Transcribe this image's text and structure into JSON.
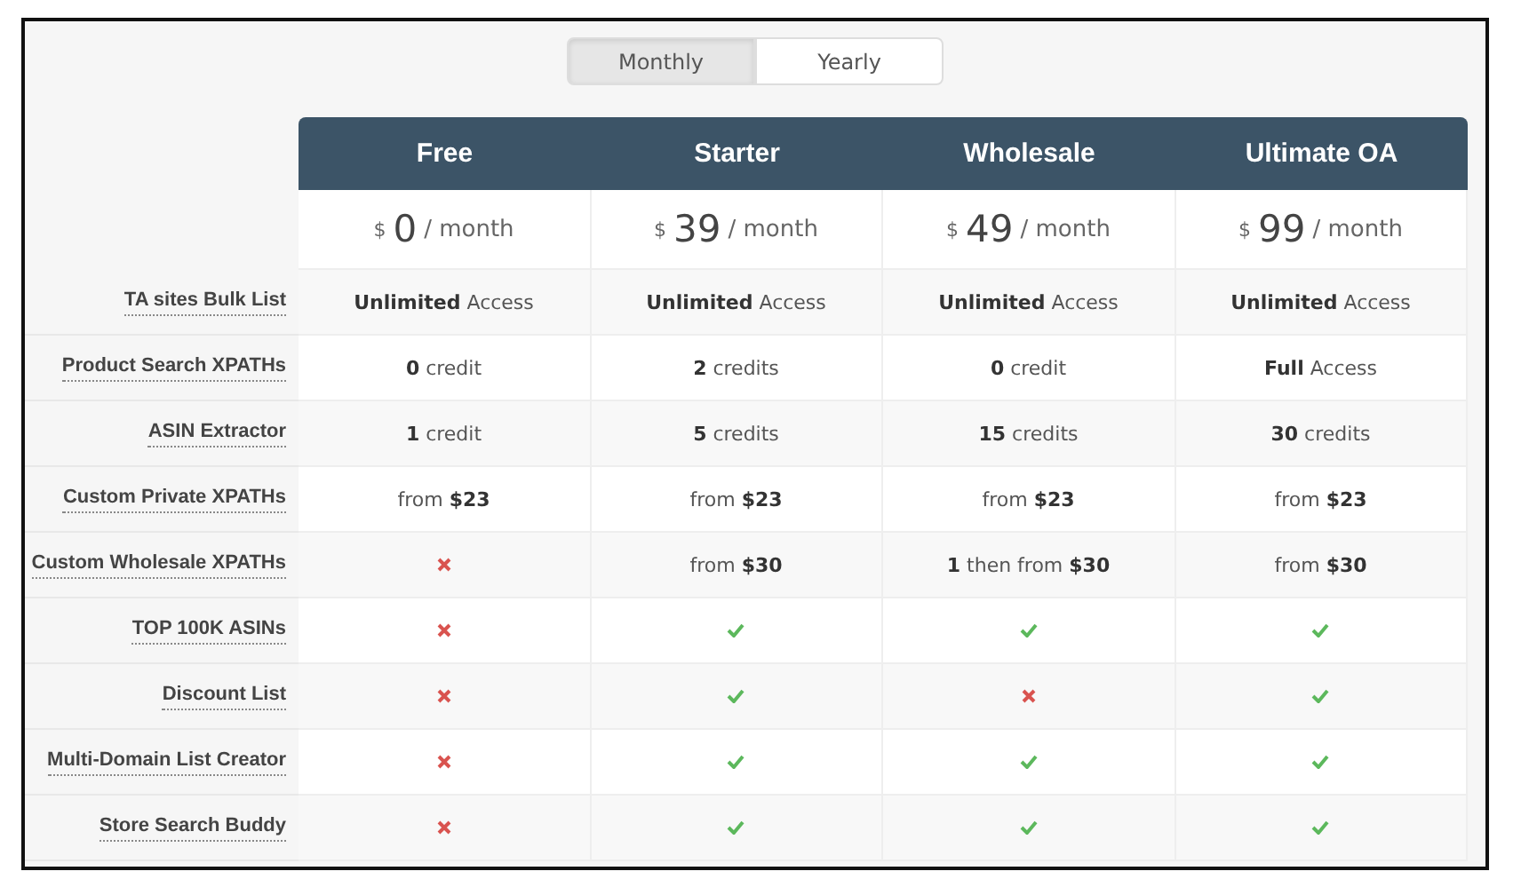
{
  "billing_toggle": [
    {
      "label": "Monthly",
      "selected": true
    },
    {
      "label": "Yearly",
      "selected": false
    }
  ],
  "plans": [
    {
      "name": "Free",
      "currency": "$",
      "price": "0",
      "period": "/ month"
    },
    {
      "name": "Starter",
      "currency": "$",
      "price": "39",
      "period": "/ month"
    },
    {
      "name": "Wholesale",
      "currency": "$",
      "price": "49",
      "period": "/ month"
    },
    {
      "name": "Ultimate OA",
      "currency": "$",
      "price": "99",
      "period": "/ month"
    }
  ],
  "features": [
    {
      "label": "TA sites Bulk List",
      "cells": [
        {
          "kind": "text",
          "text": "**Unlimited** Access"
        },
        {
          "kind": "text",
          "text": "**Unlimited** Access"
        },
        {
          "kind": "text",
          "text": "**Unlimited** Access"
        },
        {
          "kind": "text",
          "text": "**Unlimited** Access"
        }
      ]
    },
    {
      "label": "Product Search XPATHs",
      "cells": [
        {
          "kind": "text",
          "text": "**0** credit"
        },
        {
          "kind": "text",
          "text": "**2** credits"
        },
        {
          "kind": "text",
          "text": "**0** credit"
        },
        {
          "kind": "text",
          "text": "**Full** Access"
        }
      ]
    },
    {
      "label": "ASIN Extractor",
      "cells": [
        {
          "kind": "text",
          "text": "**1** credit"
        },
        {
          "kind": "text",
          "text": "**5** credits"
        },
        {
          "kind": "text",
          "text": "**15** credits"
        },
        {
          "kind": "text",
          "text": "**30** credits"
        }
      ]
    },
    {
      "label": "Custom Private XPATHs",
      "cells": [
        {
          "kind": "text",
          "text": "from **$23**"
        },
        {
          "kind": "text",
          "text": "from **$23**"
        },
        {
          "kind": "text",
          "text": "from **$23**"
        },
        {
          "kind": "text",
          "text": "from **$23**"
        }
      ]
    },
    {
      "label": "Custom Wholesale XPATHs",
      "cells": [
        {
          "kind": "no"
        },
        {
          "kind": "text",
          "text": "from **$30**"
        },
        {
          "kind": "text",
          "text": "**1** then from **$30**"
        },
        {
          "kind": "text",
          "text": "from **$30**"
        }
      ]
    },
    {
      "label": "TOP 100K ASINs",
      "cells": [
        {
          "kind": "no"
        },
        {
          "kind": "yes"
        },
        {
          "kind": "yes"
        },
        {
          "kind": "yes"
        }
      ]
    },
    {
      "label": "Discount List",
      "cells": [
        {
          "kind": "no"
        },
        {
          "kind": "yes"
        },
        {
          "kind": "no"
        },
        {
          "kind": "yes"
        }
      ]
    },
    {
      "label": "Multi-Domain List Creator",
      "cells": [
        {
          "kind": "no"
        },
        {
          "kind": "yes"
        },
        {
          "kind": "yes"
        },
        {
          "kind": "yes"
        }
      ]
    },
    {
      "label": "Store Search Buddy",
      "cells": [
        {
          "kind": "no"
        },
        {
          "kind": "yes"
        },
        {
          "kind": "yes"
        },
        {
          "kind": "yes"
        }
      ]
    }
  ]
}
